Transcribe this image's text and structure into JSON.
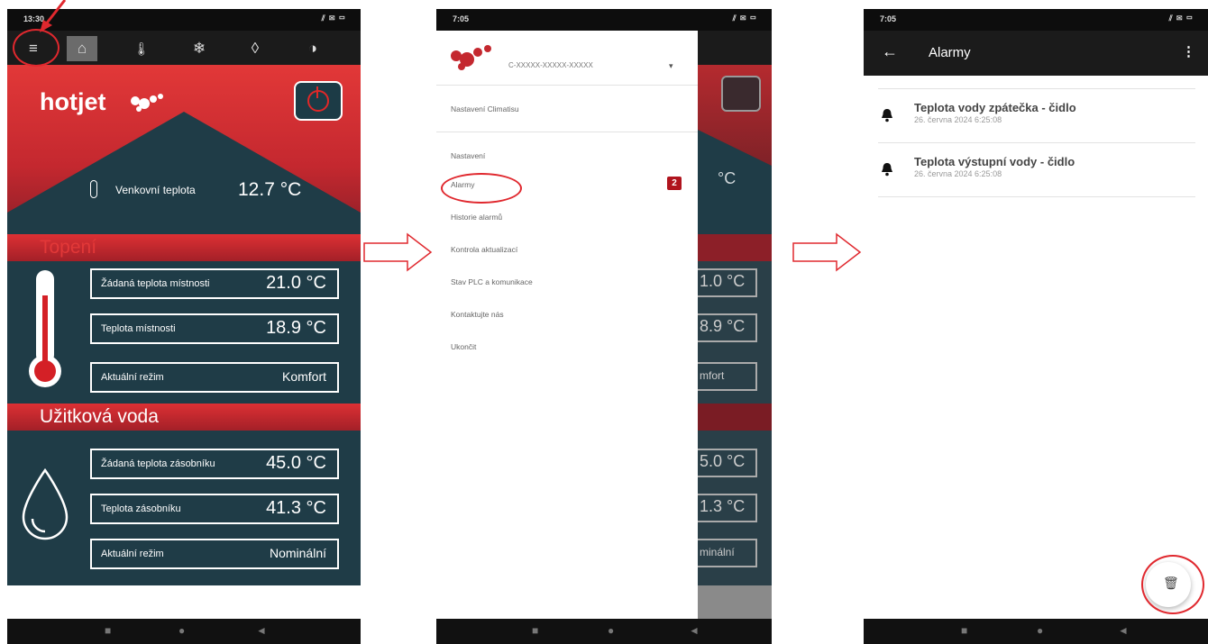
{
  "screen1": {
    "status_time": "13:30",
    "status_icons": "⫽ ✉ ▭",
    "tabs": [
      {
        "label": "≡",
        "icon": "menu-icon"
      },
      {
        "label": "⌂",
        "icon": "home-icon"
      },
      {
        "label": "🌡",
        "icon": "thermometer-icon"
      },
      {
        "label": "❄",
        "icon": "snowflake-icon"
      },
      {
        "label": "◊",
        "icon": "drop-icon"
      },
      {
        "label": "◑",
        "icon": "contrast-icon"
      }
    ],
    "brand": "hotjet",
    "outdoor_label": "Venkovní teplota",
    "outdoor_value": "12.7 °C",
    "heating_title": "Topení",
    "heating_rows": [
      {
        "label": "Žádaná teplota místnosti",
        "value": "21.0 °C"
      },
      {
        "label": "Teplota místnosti",
        "value": "18.9 °C"
      },
      {
        "label": "Aktuální režim",
        "value": "Komfort"
      }
    ],
    "water_title": "Užitková voda",
    "water_rows": [
      {
        "label": "Žádaná teplota zásobníku",
        "value": "45.0 °C"
      },
      {
        "label": "Teplota zásobníku",
        "value": "41.3 °C"
      },
      {
        "label": "Aktuální režim",
        "value": "Nominální"
      }
    ]
  },
  "screen2": {
    "status_time": "7:05",
    "status_icons": "⫽ ✉ ▭",
    "account": "C-XXXXX-XXXXX-XXXXX",
    "caret": "▾",
    "climate_settings": "Nastavení Climatisu",
    "items": [
      "Nastavení",
      "Alarmy",
      "Historie alarmů",
      "Kontrola aktualizací",
      "Stav PLC a komunikace",
      "Kontaktujte nás",
      "Ukončit"
    ],
    "alarm_badge": "2",
    "behind_values": [
      "°C",
      "1.0 °C",
      "8.9 °C",
      "mfort",
      "5.0 °C",
      "1.3 °C",
      "minální"
    ]
  },
  "screen3": {
    "status_time": "7:05",
    "status_icons": "⫽ ✉ ▭",
    "title": "Alarmy",
    "back": "←",
    "more": "⋮",
    "alarms": [
      {
        "title": "Teplota vody zpátečka - čidlo",
        "date": "26. června 2024 6:25:08"
      },
      {
        "title": "Teplota výstupní vody - čidlo",
        "date": "26. června 2024 6:25:08"
      }
    ],
    "fab_icon": "🗑"
  },
  "nav_glyphs": {
    "square": "■",
    "circle": "●",
    "back": "◄"
  },
  "colors": {
    "accent_red": "#c4282f",
    "panel_teal": "#1f3c47",
    "annotation_red": "#e0282e"
  }
}
